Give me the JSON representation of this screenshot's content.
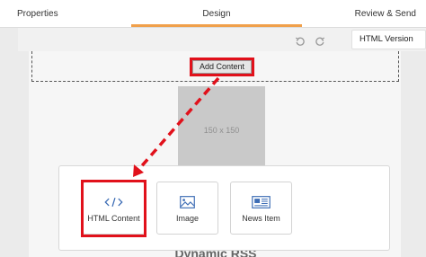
{
  "tabs": {
    "properties": "Properties",
    "design": "Design",
    "review": "Review & Send"
  },
  "toolbar": {
    "undo_icon": "undo-icon",
    "redo_icon": "redo-icon",
    "html_version_label": "HTML Version"
  },
  "canvas": {
    "add_content_label": "Add Content",
    "placeholder_label": "150 x 150",
    "dynamic_rss_label": "Dynamic RSS"
  },
  "content_picker": {
    "items": [
      {
        "label": "HTML Content",
        "icon": "code-icon"
      },
      {
        "label": "Image",
        "icon": "image-icon"
      },
      {
        "label": "News Item",
        "icon": "news-icon"
      }
    ]
  },
  "colors": {
    "active_tab_underline": "#f0a04b",
    "highlight": "#e1111b",
    "tile_icon": "#3d6db5"
  }
}
